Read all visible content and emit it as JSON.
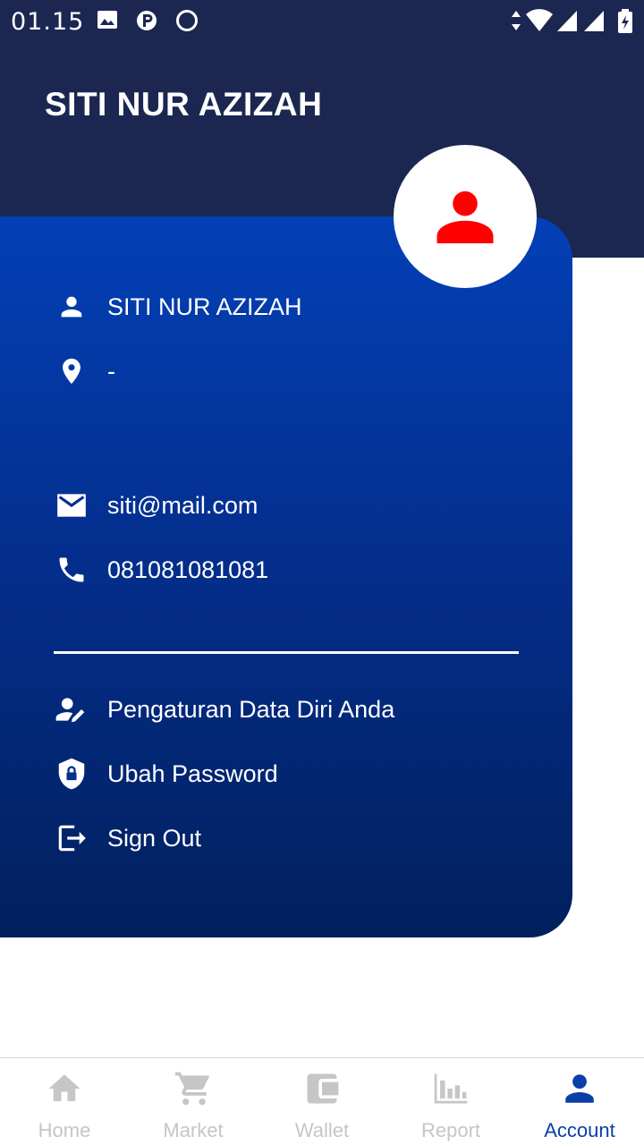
{
  "status_bar": {
    "time": "01.15"
  },
  "header": {
    "title": "SITI NUR AZIZAH"
  },
  "profile": {
    "name": "SITI NUR AZIZAH",
    "address": "-",
    "email": "siti@mail.com",
    "phone": "081081081081"
  },
  "menu": {
    "personal_data": "Pengaturan Data Diri Anda",
    "change_password": "Ubah Password",
    "sign_out": "Sign Out"
  },
  "bottom_nav": {
    "items": [
      {
        "label": "Home",
        "icon": "home-icon"
      },
      {
        "label": "Market",
        "icon": "cart-icon"
      },
      {
        "label": "Wallet",
        "icon": "wallet-icon"
      },
      {
        "label": "Report",
        "icon": "bar-chart-icon"
      },
      {
        "label": "Account",
        "icon": "person-icon"
      }
    ],
    "active": "Account"
  },
  "colors": {
    "header_bg": "#1b2751",
    "card_gradient_top": "#0340b6",
    "card_gradient_bottom": "#01205d",
    "avatar_icon": "#ff0000",
    "nav_active": "#0a3fa8",
    "nav_inactive": "#c6c6c6"
  }
}
